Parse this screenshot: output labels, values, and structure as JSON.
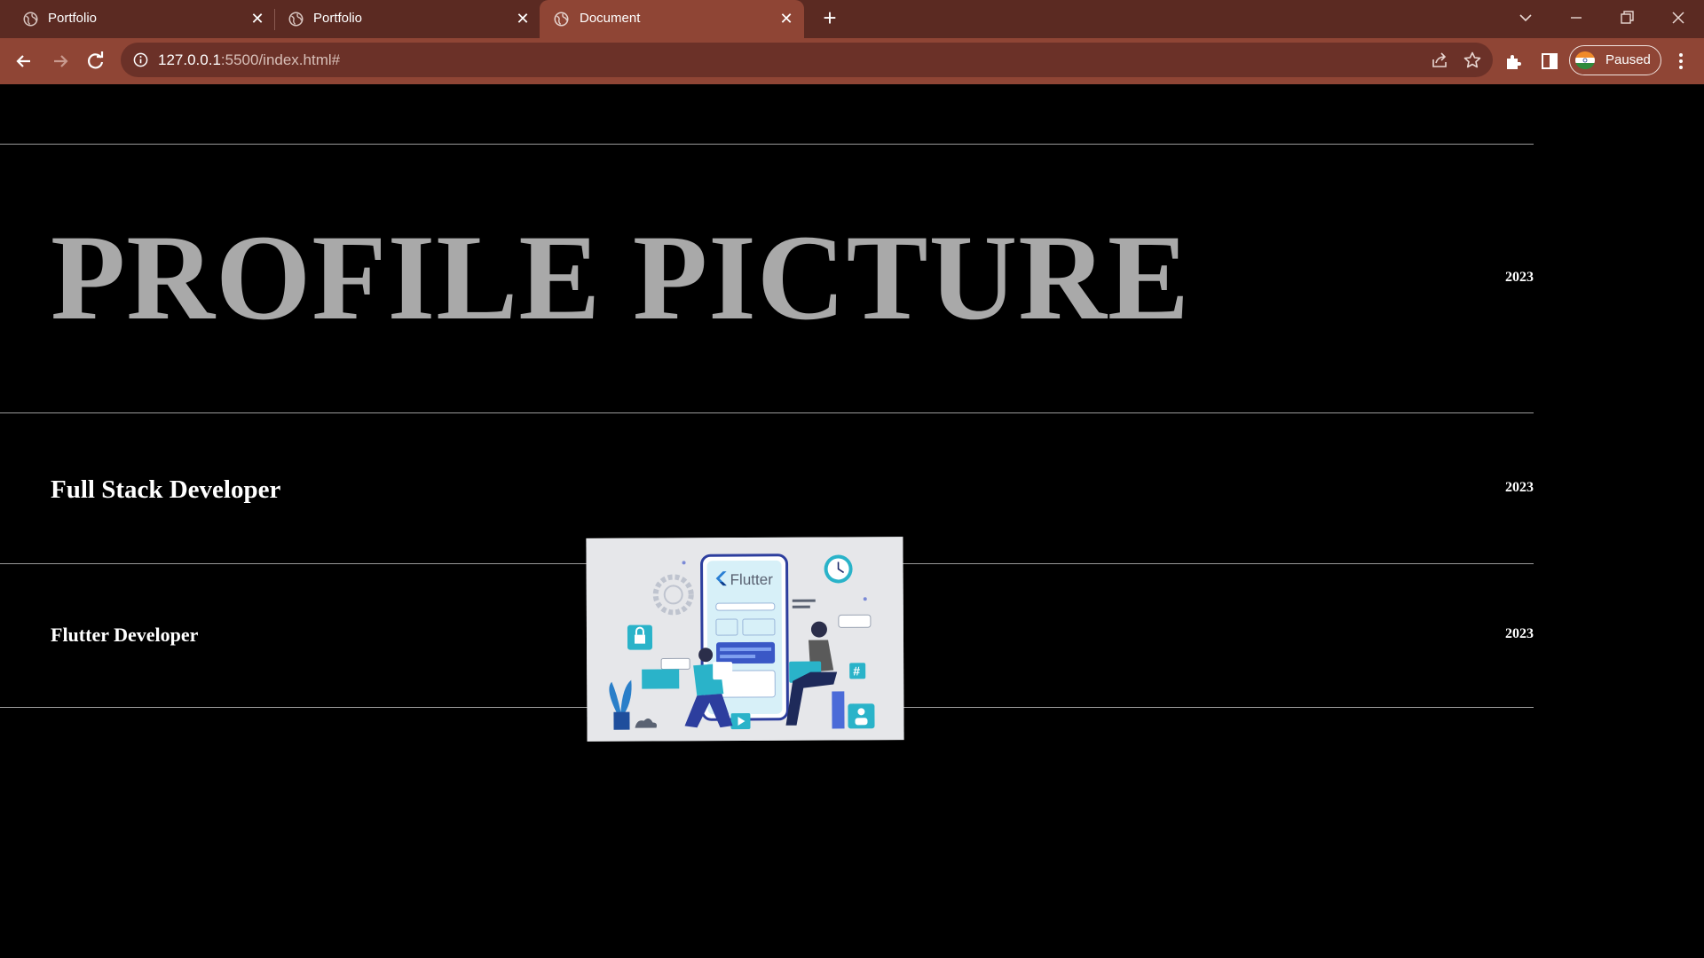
{
  "browser": {
    "tabs": [
      {
        "title": "Portfolio",
        "active": false
      },
      {
        "title": "Portfolio",
        "active": false
      },
      {
        "title": "Document",
        "active": true
      }
    ],
    "new_tab_symbol": "+",
    "close_symbol": "✕",
    "address": {
      "host": "127.0.0.1",
      "path": ":5500/index.html#"
    },
    "profile_label": "Paused",
    "icons": [
      "globe-icon",
      "back-arrow-icon",
      "forward-arrow-icon",
      "reload-icon",
      "info-icon",
      "share-icon",
      "star-icon",
      "extensions-icon",
      "side-panel-icon",
      "india-flag-icon",
      "kebab-menu-icon",
      "chevron-down-icon",
      "minimize-icon",
      "restore-icon",
      "close-icon"
    ],
    "colors": {
      "tabstrip": "#5b2a22",
      "toolbar": "#8f4535",
      "omnibox": "#6b3128"
    }
  },
  "page": {
    "rows": [
      {
        "title": "PROFILE PICTURE",
        "year": "2023"
      },
      {
        "title": "Full Stack Developer",
        "year": "2023"
      },
      {
        "title": "Flutter Developer",
        "year": "2023"
      }
    ],
    "hover_image": {
      "label": "Flutter",
      "icons": [
        "flutter-logo-icon",
        "clock-icon",
        "lock-icon",
        "hash-icon",
        "user-card-icon",
        "play-icon",
        "gear-icon",
        "plant-icon"
      ]
    },
    "colors": {
      "background": "#000000",
      "title_gray": "#a9a9a9",
      "text": "#ffffff",
      "rule": "#9a9a9a"
    }
  }
}
